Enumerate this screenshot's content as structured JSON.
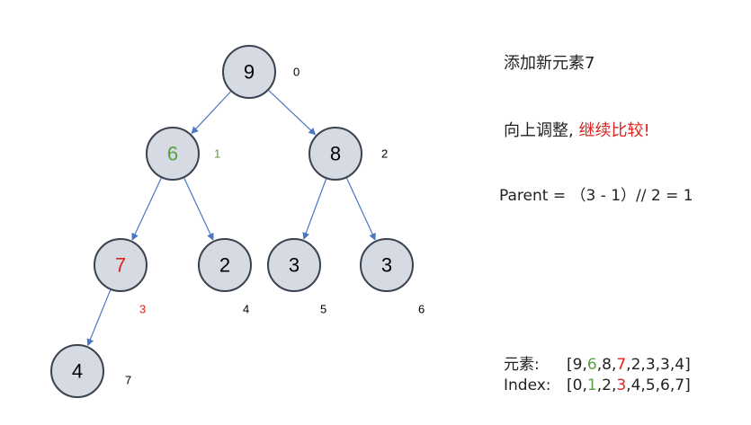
{
  "tree": {
    "nodes": [
      {
        "id": "n0",
        "value": "9",
        "index": "0",
        "value_color": "#000000",
        "index_color": "#000000"
      },
      {
        "id": "n1",
        "value": "6",
        "index": "1",
        "value_color": "#5aa040",
        "index_color": "#5aa040"
      },
      {
        "id": "n2",
        "value": "8",
        "index": "2",
        "value_color": "#000000",
        "index_color": "#000000"
      },
      {
        "id": "n3",
        "value": "7",
        "index": "3",
        "value_color": "#e0211e",
        "index_color": "#e0211e"
      },
      {
        "id": "n4",
        "value": "2",
        "index": "4",
        "value_color": "#000000",
        "index_color": "#000000"
      },
      {
        "id": "n5",
        "value": "3",
        "index": "5",
        "value_color": "#000000",
        "index_color": "#000000"
      },
      {
        "id": "n6",
        "value": "3",
        "index": "6",
        "value_color": "#000000",
        "index_color": "#000000"
      },
      {
        "id": "n7",
        "value": "4",
        "index": "7",
        "value_color": "#000000",
        "index_color": "#000000"
      }
    ],
    "edges": [
      [
        "n0",
        "n1"
      ],
      [
        "n0",
        "n2"
      ],
      [
        "n1",
        "n3"
      ],
      [
        "n1",
        "n4"
      ],
      [
        "n2",
        "n5"
      ],
      [
        "n2",
        "n6"
      ],
      [
        "n3",
        "n7"
      ]
    ]
  },
  "side": {
    "title": "添加新元素7",
    "step_prefix": "向上调整,",
    "step_highlight": "继续比较!",
    "formula": "Parent = （3 - 1）// 2 = 1"
  },
  "arrays": {
    "elements_label": "元素:",
    "elements": [
      "9",
      "6",
      "8",
      "7",
      "2",
      "3",
      "3",
      "4"
    ],
    "index_label": "Index:",
    "indices": [
      "0",
      "1",
      "2",
      "3",
      "4",
      "5",
      "6",
      "7"
    ],
    "highlights": {
      "1": "green",
      "3": "red"
    }
  },
  "colors": {
    "node_fill": "#d5dae3",
    "edge": "#4a76c4",
    "highlight_green": "#5aa040",
    "highlight_red": "#e0211e"
  }
}
